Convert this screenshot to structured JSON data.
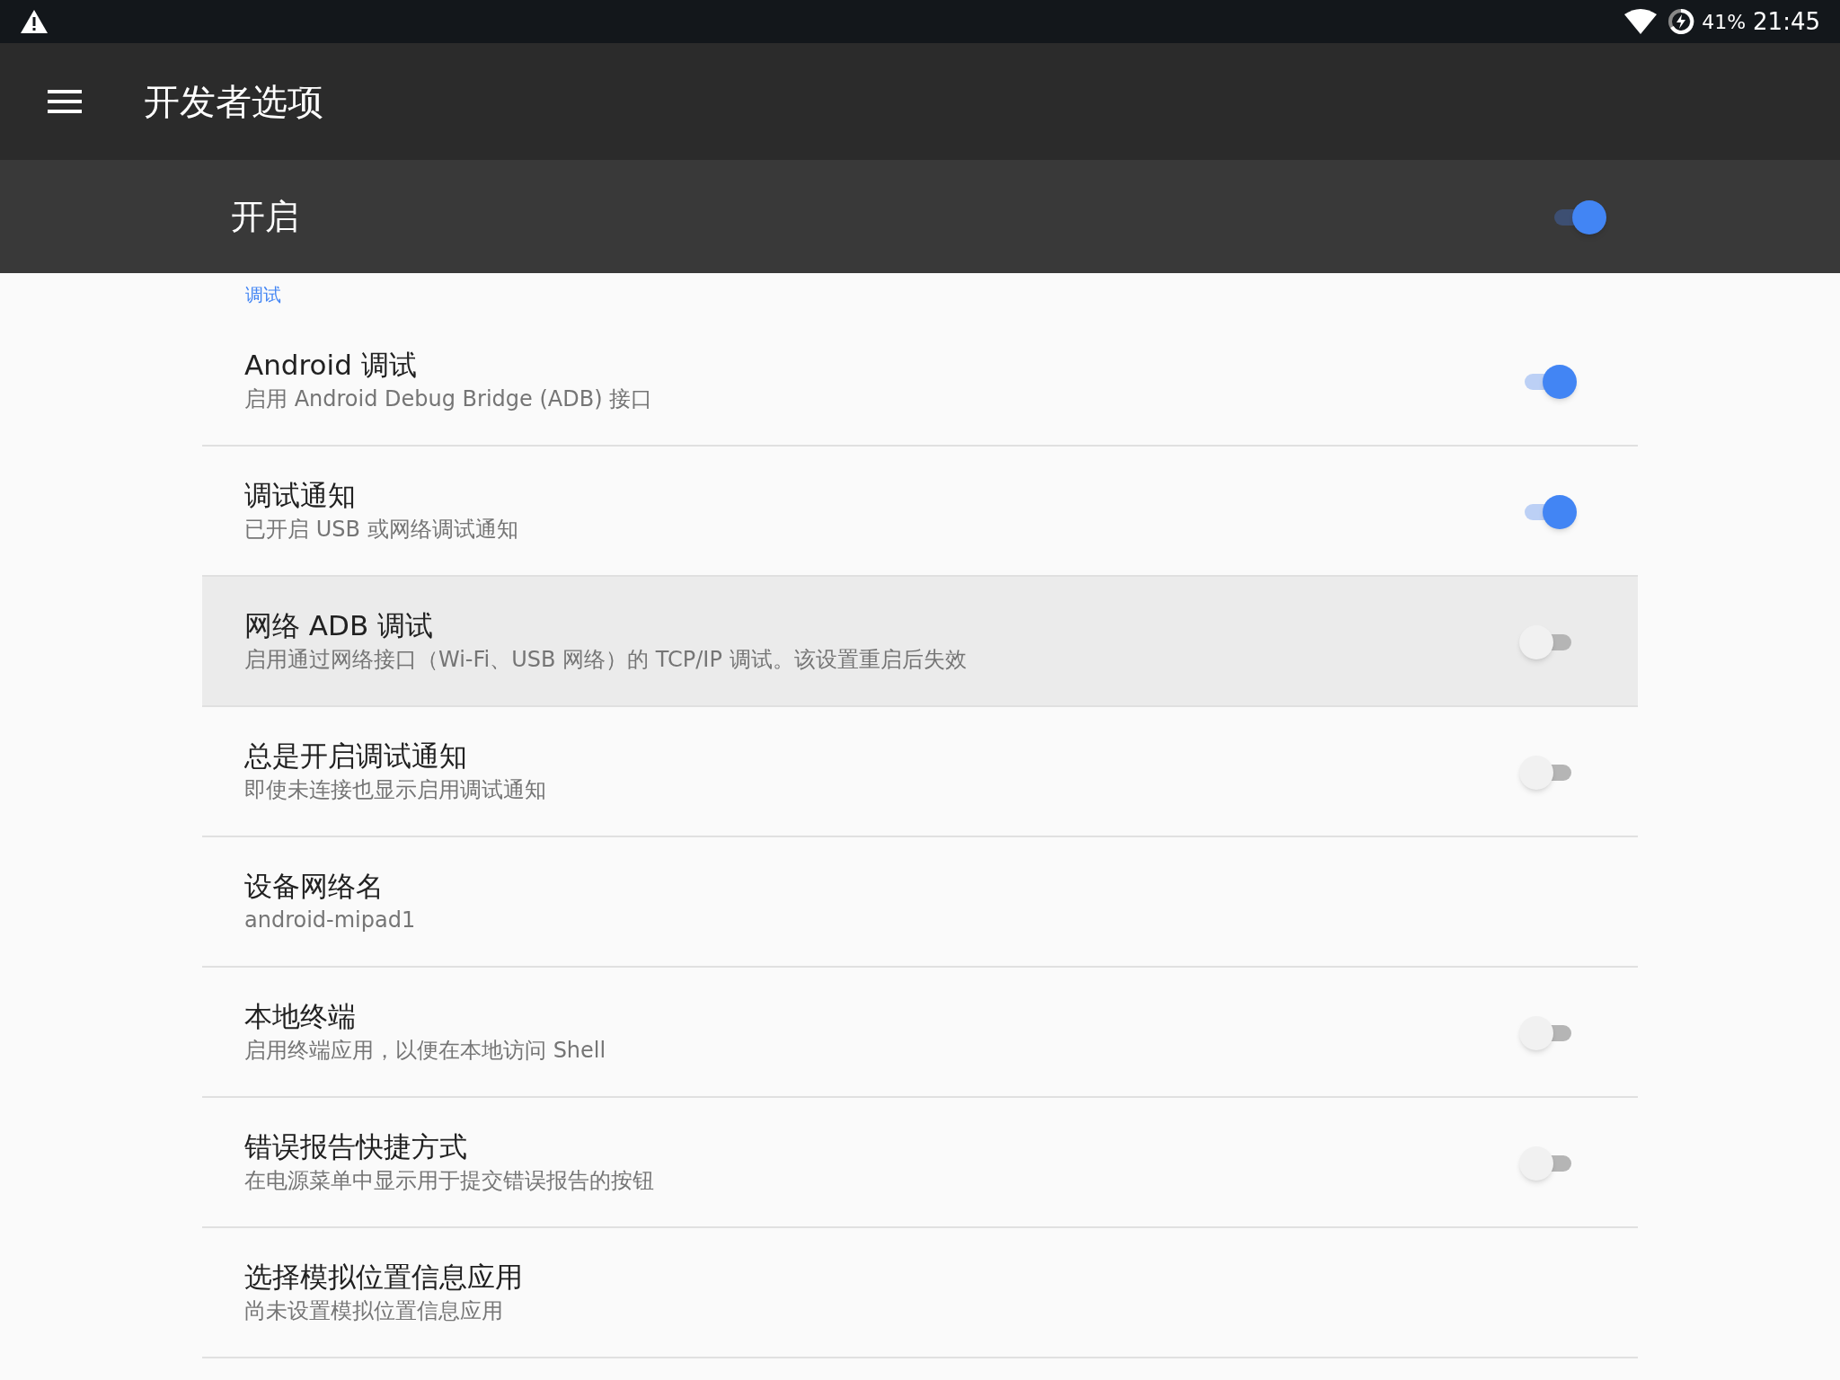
{
  "status_bar": {
    "battery": "41%",
    "time": "21:45"
  },
  "toolbar": {
    "title": "开发者选项"
  },
  "master_switch": {
    "label": "开启",
    "on": true
  },
  "section": {
    "title": "调试"
  },
  "items": [
    {
      "kind": "switch",
      "title": "Android 调试",
      "summary": "启用 Android Debug Bridge (ADB) 接口",
      "on": true,
      "selected": false
    },
    {
      "kind": "switch",
      "title": "调试通知",
      "summary": "已开启 USB 或网络调试通知",
      "on": true,
      "selected": false
    },
    {
      "kind": "switch",
      "title": "网络 ADB 调试",
      "summary": "启用通过网络接口（Wi-Fi、USB 网络）的 TCP/IP 调试。该设置重启后失效",
      "on": false,
      "selected": true
    },
    {
      "kind": "switch",
      "title": "总是开启调试通知",
      "summary": "即使未连接也显示启用调试通知",
      "on": false,
      "selected": false
    },
    {
      "kind": "plain",
      "title": "设备网络名",
      "summary": "android-mipad1",
      "selected": false
    },
    {
      "kind": "switch",
      "title": "本地终端",
      "summary": "启用终端应用，以便在本地访问 Shell",
      "on": false,
      "selected": false
    },
    {
      "kind": "switch",
      "title": "错误报告快捷方式",
      "summary": "在电源菜单中显示用于提交错误报告的按钮",
      "on": false,
      "selected": false
    },
    {
      "kind": "plain",
      "title": "选择模拟位置信息应用",
      "summary": "尚未设置模拟位置信息应用",
      "selected": false
    }
  ]
}
